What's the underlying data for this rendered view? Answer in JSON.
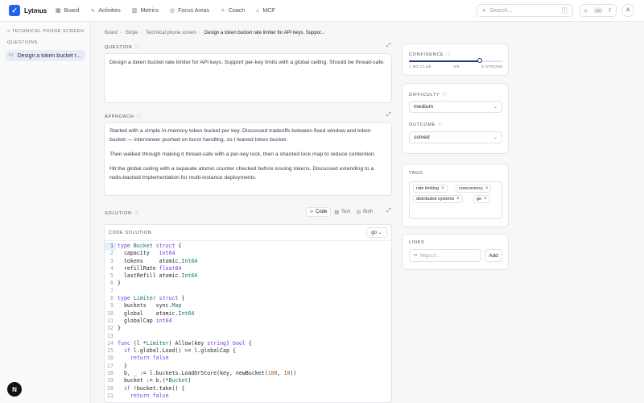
{
  "app": {
    "name": "Lytmus",
    "logo_glyph": "✓",
    "accent": "#2563eb"
  },
  "nav": [
    {
      "label": "Board",
      "icon": "board-icon",
      "glyph": "▦"
    },
    {
      "label": "Activities",
      "icon": "activity-icon",
      "glyph": "∿"
    },
    {
      "label": "Metrics",
      "icon": "metrics-icon",
      "glyph": "▥"
    },
    {
      "label": "Focus Areas",
      "icon": "target-icon",
      "glyph": "◎"
    },
    {
      "label": "Coach",
      "icon": "coach-icon",
      "glyph": "✧"
    },
    {
      "label": "MCP",
      "icon": "mcp-icon",
      "glyph": "⌂"
    }
  ],
  "search": {
    "placeholder": "Search...",
    "shortcut": "/"
  },
  "avatar": "A",
  "sidebar": {
    "back_label": "< TECHNICAL PHONE SCREEN",
    "section": "QUESTIONS",
    "items": [
      {
        "num": "01",
        "label": "Design a token bucket r..."
      }
    ]
  },
  "breadcrumb": [
    "Board",
    "Stripe",
    "Technical phone screen",
    "Design a token bucket rate limiter for API keys. Suppor..."
  ],
  "question": {
    "label": "QUESTION",
    "text": "Design a token bucket rate limiter for API keys. Support per-key limits with a global ceiling. Should be thread-safe."
  },
  "approach": {
    "label": "APPROACH",
    "paragraphs": [
      "Started with a simple in-memory token bucket per key. Discussed tradeoffs between fixed window and token bucket — interviewer pushed on burst handling, so I leaned token bucket.",
      "Then walked through making it thread-safe with a per-key lock, then a sharded lock map to reduce contention.",
      "Hit the global ceiling with a separate atomic counter checked before issuing tokens. Discussed extending to a redis-backed implementation for multi-instance deployments."
    ]
  },
  "solution": {
    "label": "SOLUTION",
    "modes": [
      "Code",
      "Text",
      "Both"
    ],
    "active_mode": "Code",
    "code_header": "CODE SOLUTION",
    "language": "go",
    "lines": [
      "type Bucket struct {",
      "  capacity   int64",
      "  tokens     atomic.Int64",
      "  refillRate float64",
      "  lastRefill atomic.Int64",
      "}",
      "",
      "type Limiter struct {",
      "  buckets   sync.Map",
      "  global    atomic.Int64",
      "  globalCap int64",
      "}",
      "",
      "func (l *Limiter) Allow(key string) bool {",
      "  if l.global.Load() >= l.globalCap {",
      "    return false",
      "  }",
      "  b, _ := l.buckets.LoadOrStore(key, newBucket(100, 10))",
      "  bucket := b.(*Bucket)",
      "  if !bucket.take() {",
      "    return false"
    ]
  },
  "confidence": {
    "label": "CONFIDENCE",
    "value": 4,
    "max": 5,
    "ticks": [
      "1 NO CLUE",
      "4/5",
      "5 STRONG"
    ]
  },
  "difficulty": {
    "label": "DIFFICULTY",
    "value": "medium"
  },
  "outcome": {
    "label": "OUTCOME",
    "value": "solved"
  },
  "tags": {
    "label": "TAGS",
    "items": [
      "rate limiting",
      "concurrency",
      "distributed systems",
      "go"
    ]
  },
  "links": {
    "label": "LINKS",
    "placeholder": "https://...",
    "add_label": "Add"
  },
  "fab": "N"
}
